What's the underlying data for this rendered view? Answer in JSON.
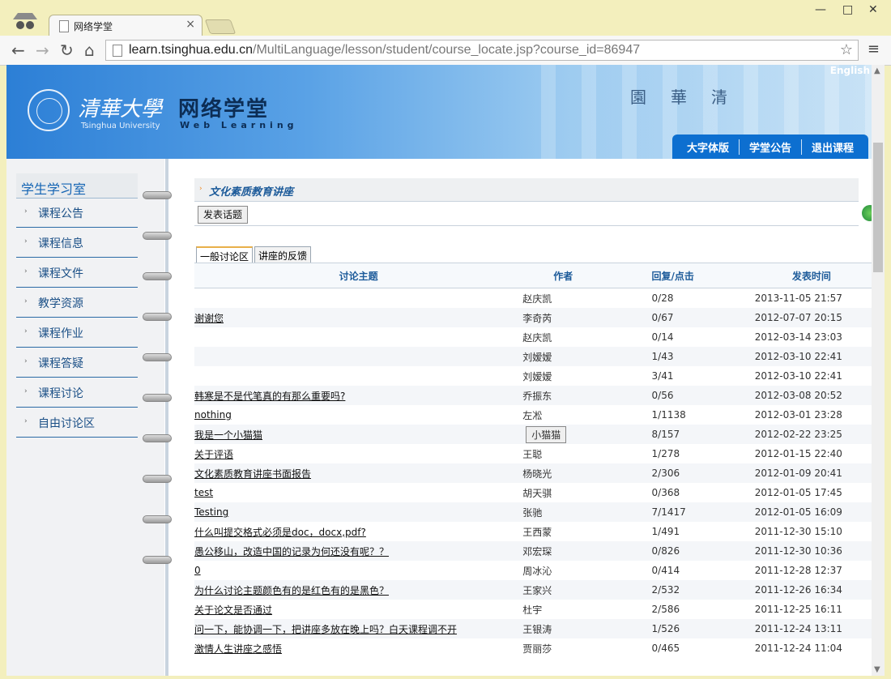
{
  "browser": {
    "tab_title": "网络学堂",
    "tab_close": "×",
    "url_host": "learn.tsinghua.edu.cn",
    "url_path": "/MultiLanguage/lesson/student/course_locate.jsp?course_id=86947",
    "back": "←",
    "forward": "→",
    "reload": "↻",
    "home": "⌂",
    "star": "☆",
    "menu": "≡",
    "min": "—",
    "max": "□",
    "close": "✕"
  },
  "banner": {
    "brand_cn": "清華大學",
    "brand_en": "Tsinghua University",
    "site_cn": "网络学堂",
    "site_en": "Web Learning",
    "gate_sign": "園華清",
    "english_link": "English"
  },
  "topnav": [
    "大字体版",
    "学堂公告",
    "退出课程"
  ],
  "sidebar": {
    "heading": "学生学习室",
    "items": [
      "课程公告",
      "课程信息",
      "课程文件",
      "教学资源",
      "课程作业",
      "课程答疑",
      "课程讨论",
      "自由讨论区"
    ]
  },
  "content": {
    "course_name": "文化素质教育讲座",
    "post_button": "发表话题",
    "refresh_label": "refresh",
    "tabs": [
      "一般讨论区",
      "讲座的反馈"
    ],
    "columns": [
      "讨论主题",
      "作者",
      "回复/点击",
      "发表时间"
    ],
    "rows": [
      {
        "topic": "",
        "author": "赵庆凯",
        "replies": "0/28",
        "time": "2013-11-05 21:57"
      },
      {
        "topic": "谢谢您",
        "author": "李奇芮",
        "replies": "0/67",
        "time": "2012-07-07 20:15"
      },
      {
        "topic": "",
        "author": "赵庆凯",
        "replies": "0/14",
        "time": "2012-03-14 23:03"
      },
      {
        "topic": "",
        "author": "刘嫒嫒",
        "replies": "1/43",
        "time": "2012-03-10 22:41"
      },
      {
        "topic": "",
        "author": "刘嫒嫒",
        "replies": "3/41",
        "time": "2012-03-10 22:41"
      },
      {
        "topic": "韩寒是不是代笔真的有那么重要吗?",
        "author": "乔振东",
        "replies": "0/56",
        "time": "2012-03-08 20:52"
      },
      {
        "topic": "nothing",
        "author": "左凇",
        "replies": "1/1138",
        "time": "2012-03-01 23:28"
      },
      {
        "topic": "我是一个小猫猫",
        "author": "小猫猫",
        "replies": "8/157",
        "time": "2012-02-22 23:25"
      },
      {
        "topic": "关于评语",
        "author": "王聪",
        "replies": "1/278",
        "time": "2012-01-15 22:40"
      },
      {
        "topic": "文化素质教育讲座书面报告",
        "author": "杨晓光",
        "replies": "2/306",
        "time": "2012-01-09 20:41"
      },
      {
        "topic": "test",
        "author": "胡天骐",
        "replies": "0/368",
        "time": "2012-01-05 17:45"
      },
      {
        "topic": "Testing",
        "author": "张驰",
        "replies": "7/1417",
        "time": "2012-01-05 16:09"
      },
      {
        "topic": "什么叫提交格式必须是doc，docx,pdf?",
        "author": "王西蒙",
        "replies": "1/491",
        "time": "2011-12-30 15:10"
      },
      {
        "topic": "愚公移山，改造中国的记录为何还没有呢？？",
        "author": "邓宏琛",
        "replies": "0/826",
        "time": "2011-12-30 10:36"
      },
      {
        "topic": "0",
        "author": "周冰沁",
        "replies": "0/414",
        "time": "2011-12-28 12:37"
      },
      {
        "topic": "为什么讨论主题颜色有的是红色有的是黑色？",
        "author": "王家兴",
        "replies": "2/532",
        "time": "2011-12-26 16:34"
      },
      {
        "topic": "关于论文是否通过",
        "author": "杜宇",
        "replies": "2/586",
        "time": "2011-12-25 16:11"
      },
      {
        "topic": "问一下，能协调一下，把讲座多放在晚上吗？白天课程调不开",
        "author": "王银涛",
        "replies": "1/526",
        "time": "2011-12-24 13:11"
      },
      {
        "topic": "激情人生讲座之感悟",
        "author": "贾丽莎",
        "replies": "0/465",
        "time": "2011-12-24 11:04"
      }
    ]
  },
  "colors": {
    "frame": "#f3efbd",
    "link_blue": "#1d5b9a",
    "nav_blue": "#0d6fd0",
    "accent_orange": "#f08a24"
  }
}
